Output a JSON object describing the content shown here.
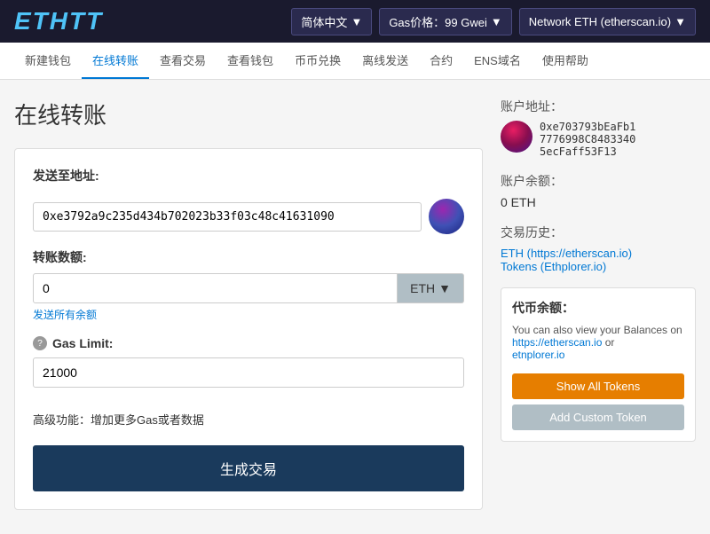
{
  "header": {
    "logo": "ETHTT",
    "lang_label": "简体中文",
    "gas_label": "Gas价格：99 Gwei",
    "network_label": "Network ETH (etherscan.io)"
  },
  "nav": {
    "items": [
      {
        "label": "新建钱包",
        "active": false
      },
      {
        "label": "在线转账",
        "active": true
      },
      {
        "label": "查看交易",
        "active": false
      },
      {
        "label": "查看钱包",
        "active": false
      },
      {
        "label": "币币兑换",
        "active": false
      },
      {
        "label": "离线发送",
        "active": false
      },
      {
        "label": "合约",
        "active": false
      },
      {
        "label": "ENS域名",
        "active": false
      },
      {
        "label": "使用帮助",
        "active": false
      }
    ]
  },
  "page": {
    "title": "在线转账",
    "form": {
      "address_label": "发送至地址:",
      "address_value": "0xe3792a9c235d434b702023b33f03c48c41631090",
      "amount_label": "转账数额:",
      "amount_value": "0",
      "token_label": "ETH",
      "send_all_label": "发送所有余额",
      "gas_label": "Gas Limit:",
      "gas_value": "21000",
      "advanced_label": "高级功能：",
      "advanced_link": "增加更多Gas或者数据",
      "generate_btn": "生成交易"
    },
    "sidebar": {
      "account_label": "账户地址：",
      "account_address": "0xe703793bEaFb17776998C8483340 5ecFaff53F13",
      "balance_label": "账户余额：",
      "balance_value": "0 ETH",
      "history_label": "交易历史：",
      "history_eth": "ETH (https://etherscan.io)",
      "history_tokens": "Tokens (Ethplorer.io)",
      "token_balance_label": "代币余额：",
      "token_desc1": "You can also view your Balances on",
      "token_link1": "https://etherscan.io",
      "token_desc2": " or",
      "token_link2": "etnplorer.io",
      "show_all_btn": "Show All Tokens",
      "add_custom_btn": "Add Custom Token"
    }
  }
}
